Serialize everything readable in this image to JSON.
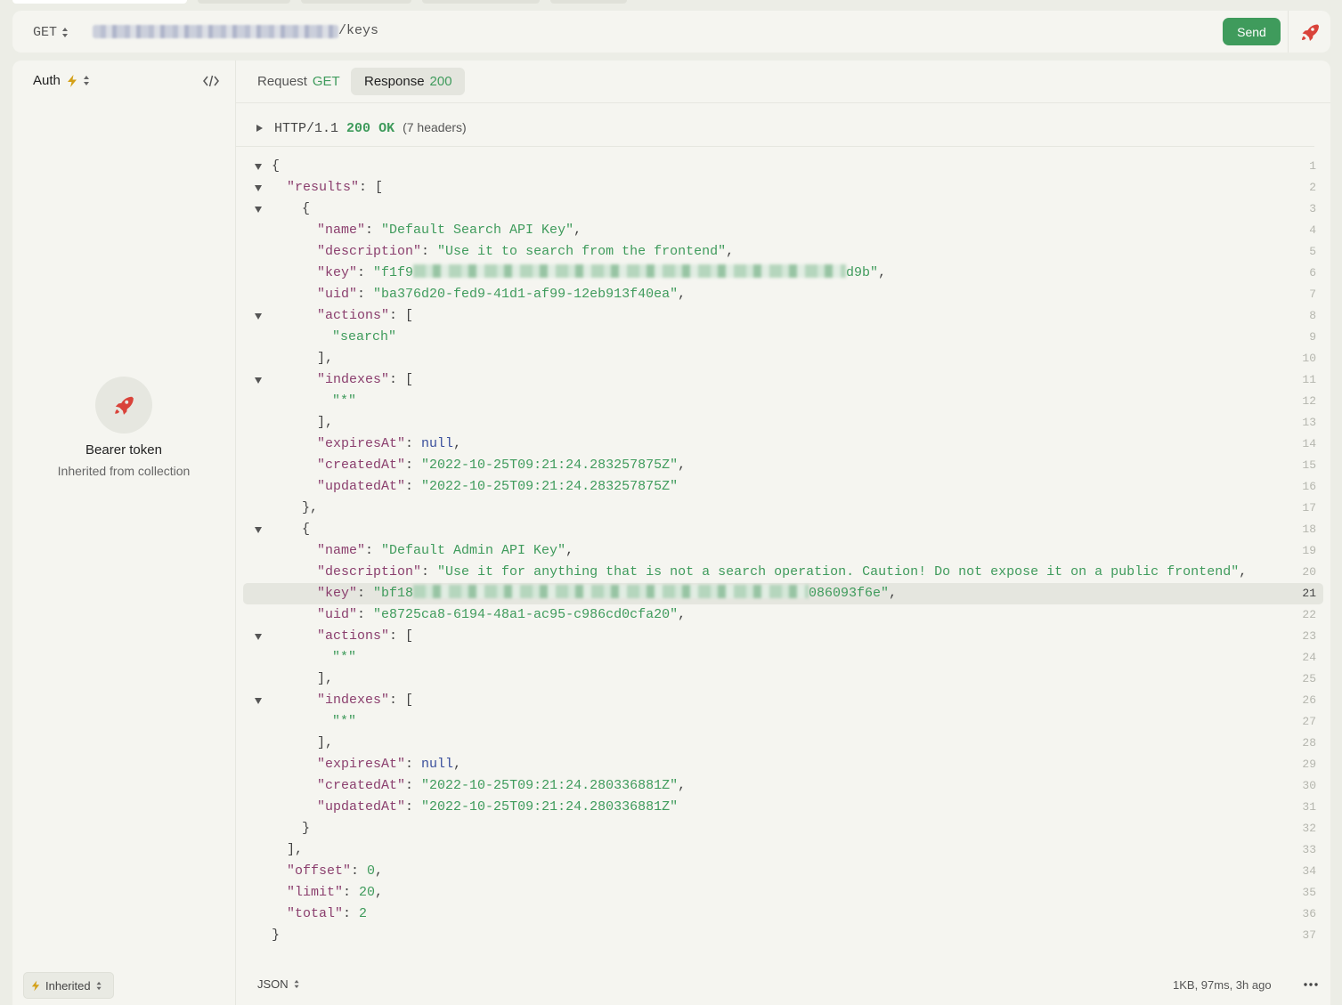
{
  "request": {
    "method": "GET",
    "url_visible_suffix": "/keys",
    "send_label": "Send"
  },
  "sidebar": {
    "auth_label": "Auth",
    "auth_type_title": "Bearer token",
    "auth_type_subtitle": "Inherited from collection",
    "inherited_label": "Inherited"
  },
  "tabs": {
    "request_label": "Request",
    "request_method": "GET",
    "response_label": "Response",
    "response_status": "200"
  },
  "response": {
    "protocol": "HTTP/1.1",
    "status_code": "200",
    "status_text": "OK",
    "headers_count_label": "(7 headers)",
    "format": "JSON",
    "meta": "1KB, 97ms, 3h ago",
    "body": {
      "results": [
        {
          "name": "Default Search API Key",
          "description": "Use it to search from the frontend",
          "key_prefix": "f1f9",
          "key_suffix": "d9b",
          "uid": "ba376d20-fed9-41d1-af99-12eb913f40ea",
          "actions": [
            "search"
          ],
          "indexes": [
            "*"
          ],
          "expiresAt": "null",
          "createdAt": "2022-10-25T09:21:24.283257875Z",
          "updatedAt": "2022-10-25T09:21:24.283257875Z"
        },
        {
          "name": "Default Admin API Key",
          "description": "Use it for anything that is not a search operation. Caution! Do not expose it on a public frontend",
          "key_prefix": "bf18",
          "key_suffix": "086093f6e",
          "uid": "e8725ca8-6194-48a1-ac95-c986cd0cfa20",
          "actions": [
            "*"
          ],
          "indexes": [
            "*"
          ],
          "expiresAt": "null",
          "createdAt": "2022-10-25T09:21:24.280336881Z",
          "updatedAt": "2022-10-25T09:21:24.280336881Z"
        }
      ],
      "offset": "0",
      "limit": "20",
      "total": "2"
    },
    "highlighted_line": 21
  },
  "colors": {
    "accent_green": "#3f9b5c",
    "json_key": "#8b3f6e",
    "json_null": "#3a4f9c",
    "rocket_red": "#d9433a"
  },
  "icons": {
    "method_toggle": "chevron-updown-icon",
    "rocket": "rocket-icon",
    "bolt": "lightning-bolt-icon",
    "code": "code-brackets-icon",
    "expand": "triangle-right-icon",
    "collapse": "triangle-down-icon",
    "more": "more-horizontal-icon"
  }
}
